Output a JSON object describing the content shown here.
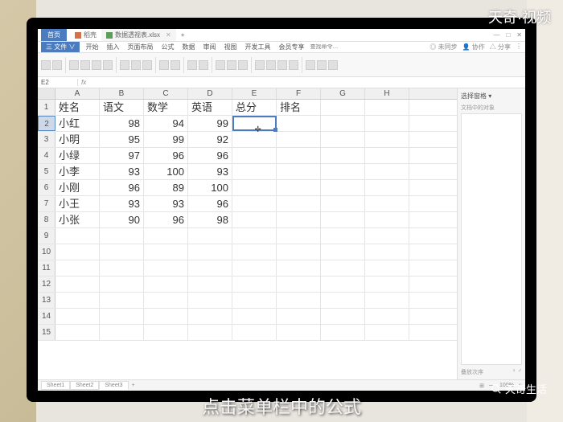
{
  "watermark_tr": "天奇·视频",
  "watermark_br": "天奇生活",
  "caption": "点击菜单栏中的公式",
  "app_button": "首页",
  "tabs": [
    {
      "label": "稻壳",
      "active": false
    },
    {
      "label": "数据透视表.xlsx",
      "active": true
    }
  ],
  "tab_plus": "+",
  "win_controls": [
    "—",
    "□",
    "✕"
  ],
  "menu": {
    "file": "三 文件 ∨",
    "items": [
      "开始",
      "插入",
      "页面布局",
      "公式",
      "数据",
      "审阅",
      "视图",
      "开发工具",
      "会员专享"
    ],
    "search_placeholder": "查找命令…",
    "right": [
      "◎ 未同步",
      "👤 协作",
      "△ 分享",
      "⋮"
    ]
  },
  "namebox": "E2",
  "fx_label": "fx",
  "columns": [
    "A",
    "B",
    "C",
    "D",
    "E",
    "F",
    "G",
    "H"
  ],
  "table": {
    "header_row": 1,
    "headers": [
      "姓名",
      "语文",
      "数学",
      "英语",
      "总分",
      "排名"
    ],
    "rows": [
      {
        "n": 2,
        "cells": [
          "小红",
          98,
          94,
          99,
          "",
          ""
        ]
      },
      {
        "n": 3,
        "cells": [
          "小明",
          95,
          99,
          92,
          "",
          ""
        ]
      },
      {
        "n": 4,
        "cells": [
          "小绿",
          97,
          96,
          96,
          "",
          ""
        ]
      },
      {
        "n": 5,
        "cells": [
          "小李",
          93,
          100,
          93,
          "",
          ""
        ]
      },
      {
        "n": 6,
        "cells": [
          "小刚",
          96,
          89,
          100,
          "",
          ""
        ]
      },
      {
        "n": 7,
        "cells": [
          "小王",
          93,
          93,
          96,
          "",
          ""
        ]
      },
      {
        "n": 8,
        "cells": [
          "小张",
          90,
          96,
          98,
          "",
          ""
        ]
      }
    ],
    "empty_rows": [
      9,
      10,
      11,
      12,
      13,
      14,
      15
    ]
  },
  "selected_cell": "E2",
  "selected_row_hdr": 2,
  "side": {
    "title": "选择窗格 ▾",
    "subtitle": "文档中的对象",
    "footer_l": "叠放次序",
    "footer_r": "♀ ♂"
  },
  "sheets": [
    "Sheet1",
    "Sheet2",
    "Sheet3"
  ],
  "sheet_active": 2,
  "status_right": [
    "⊞",
    "—",
    "100%",
    "+"
  ]
}
